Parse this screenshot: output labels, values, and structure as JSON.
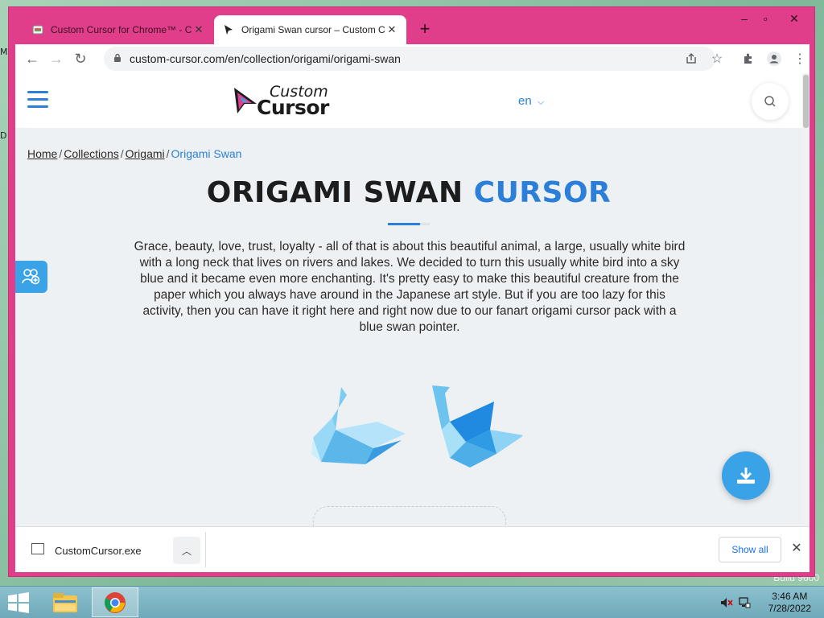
{
  "desktop": {
    "edge_letters": [
      "M",
      "D"
    ],
    "watermark": "Build 9600"
  },
  "tabs": [
    {
      "title": "Custom Cursor for Chrome™ - Ch",
      "active": false
    },
    {
      "title": "Origami Swan cursor – Custom C",
      "active": true
    }
  ],
  "address_bar": {
    "url": "custom-cursor.com/en/collection/origami/origami-swan"
  },
  "site": {
    "logo_line1": "Custom",
    "logo_line2": "Cursor",
    "language": "en"
  },
  "breadcrumb": [
    {
      "label": "Home"
    },
    {
      "label": "Collections"
    },
    {
      "label": "Origami"
    },
    {
      "label": "Origami Swan"
    }
  ],
  "page": {
    "title_main": "ORIGAMI SWAN",
    "title_accent": "CURSOR",
    "description": "Grace, beauty, love, trust, loyalty - all of that is about this beautiful animal, a large, usually white bird with a long neck that lives on rivers and lakes. We decided to turn this usually white bird into a sky blue and it became even more enchanting. It's pretty easy to make this beautiful creature from the paper which you always have around in the Japanese art style. But if you are too lazy for this activity, then you can have it right here and right now due to our fanart origami cursor pack with a blue swan pointer."
  },
  "download_shelf": {
    "file_name": "CustomCursor.exe",
    "show_all_label": "Show all"
  },
  "taskbar": {
    "time": "3:46 AM",
    "date": "7/28/2022"
  },
  "colors": {
    "window_frame": "#e03d8a",
    "accent": "#2b7fd8",
    "fab": "#3aa3e8"
  }
}
